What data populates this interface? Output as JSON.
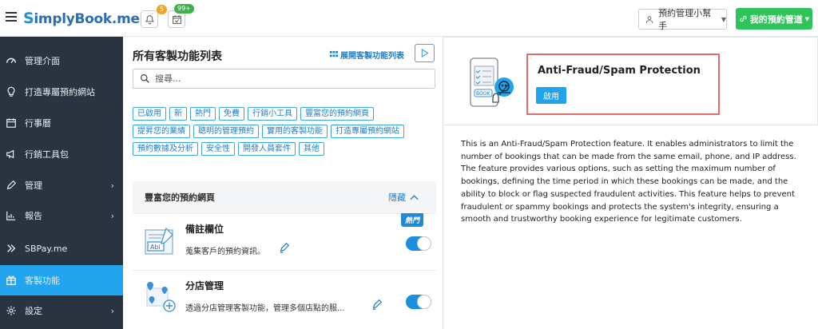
{
  "header": {
    "logo_text": "implyBook.me",
    "logo_s": "S",
    "notif_count": "5",
    "task_count": "99+",
    "user_menu": "預約管理小幫手",
    "my_booking": "我的預約管道"
  },
  "sidebar": {
    "items": [
      {
        "label": "管理介面",
        "icon": "speedometer-icon",
        "arrow": false
      },
      {
        "label": "打造專屬預約網站",
        "icon": "lightbulb-icon",
        "arrow": false
      },
      {
        "label": "行事曆",
        "icon": "calendar-icon",
        "arrow": false
      },
      {
        "label": "行銷工具包",
        "icon": "megaphone-icon",
        "arrow": false
      },
      {
        "label": "管理",
        "icon": "pencil-icon",
        "arrow": true
      },
      {
        "label": "報告",
        "icon": "chart-icon",
        "arrow": true
      },
      {
        "label": "SBPay.me",
        "icon": "sbpay-icon",
        "arrow": false
      },
      {
        "label": "客製功能",
        "icon": "puzzle-icon",
        "arrow": false,
        "active": true
      },
      {
        "label": "設定",
        "icon": "gear-icon",
        "arrow": true
      }
    ]
  },
  "features_panel": {
    "title": "所有客製功能列表",
    "expand_label": "展開客製功能列表",
    "search_placeholder": "搜尋...",
    "tags_rows": [
      [
        "已啟用",
        "新",
        "熱門",
        "免費",
        "行銷小工具",
        "豐富您的預約網頁"
      ],
      [
        "提昇您的業績",
        "聰明的管理預約",
        "實用的客製功能",
        "打造專屬預約網站"
      ],
      [
        "預約數據及分析",
        "安全性",
        "開發人員套件",
        "其他"
      ]
    ],
    "section_title": "豐富您的預約網頁",
    "hide_label": "隱藏",
    "features": [
      {
        "name": "備註欄位",
        "desc": "蒐集客戶的預約資訊。",
        "hot": "熱門",
        "enabled": true
      },
      {
        "name": "分店管理",
        "desc": "透過分店管理客製功能，管理多個店點的服...",
        "enabled": true
      }
    ]
  },
  "detail": {
    "title": "Anti-Fraud/Spam Protection",
    "enable_label": "啟用",
    "illustration_text": "BOOK",
    "description": "This is an Anti-Fraud/Spam Protection feature. It enables administrators to limit the number of bookings that can be made from the same email, phone, and IP address. The feature provides various options, such as setting the maximum number of bookings, defining the time period in which these bookings can be made, and the ability to block or flag suspected fraudulent activities. This feature helps to prevent fraudulent or spammy bookings and protects the system's integrity, ensuring a smooth and trustworthy booking experience for legitimate customers."
  },
  "colors": {
    "sidebar_bg": "#2a3340",
    "active": "#22a4ef",
    "primary_green": "#2ec45a",
    "highlight_red": "#e46b6b"
  }
}
